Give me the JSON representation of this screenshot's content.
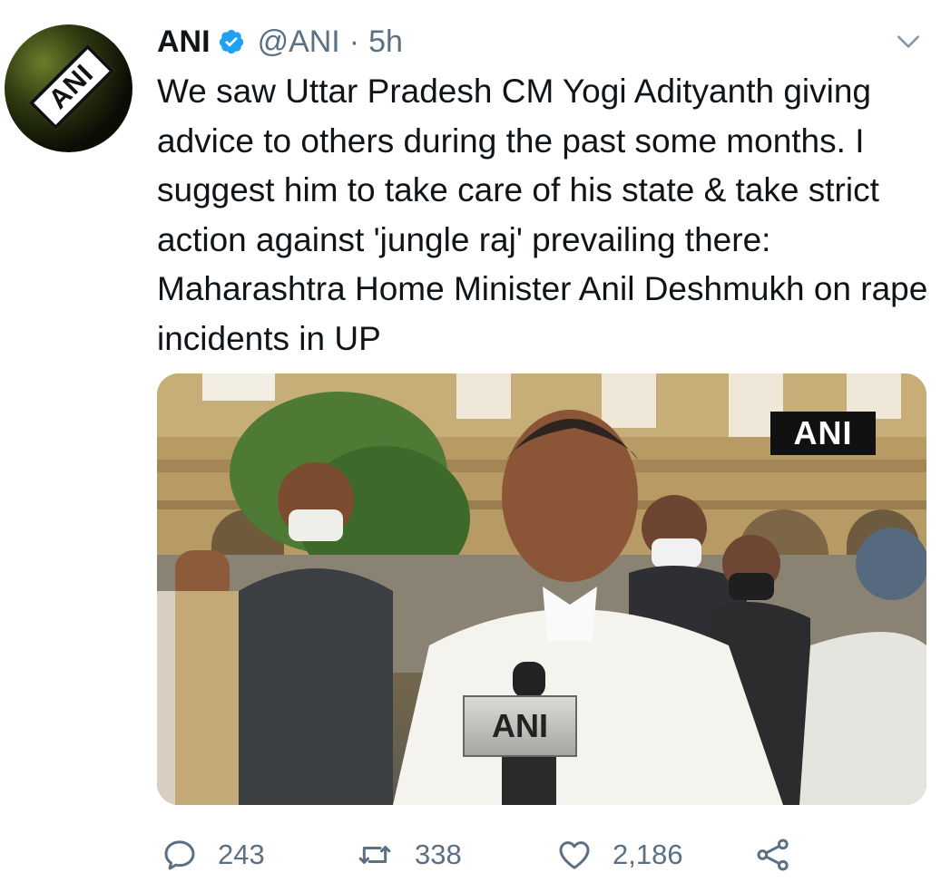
{
  "tweet": {
    "author_name": "ANI",
    "handle": "@ANI",
    "separator": "·",
    "time": "5h",
    "avatar_text": "ANI",
    "text": "We saw Uttar Pradesh CM Yogi Adityanth giving advice to others during the past some months. I suggest him to take care of his state & take strict action against 'jungle raj' prevailing there: Maharashtra Home Minister Anil Deshmukh on rape incidents in UP",
    "media": {
      "watermark": "ANI",
      "mic_label": "ANI"
    },
    "actions": {
      "replies": "243",
      "retweets": "338",
      "likes": "2,186"
    }
  },
  "colors": {
    "verified": "#1da1f2",
    "secondary_text": "#5b7083"
  },
  "icons": [
    "verified-icon",
    "chevron-down-icon",
    "reply-icon",
    "retweet-icon",
    "like-icon",
    "share-icon"
  ]
}
